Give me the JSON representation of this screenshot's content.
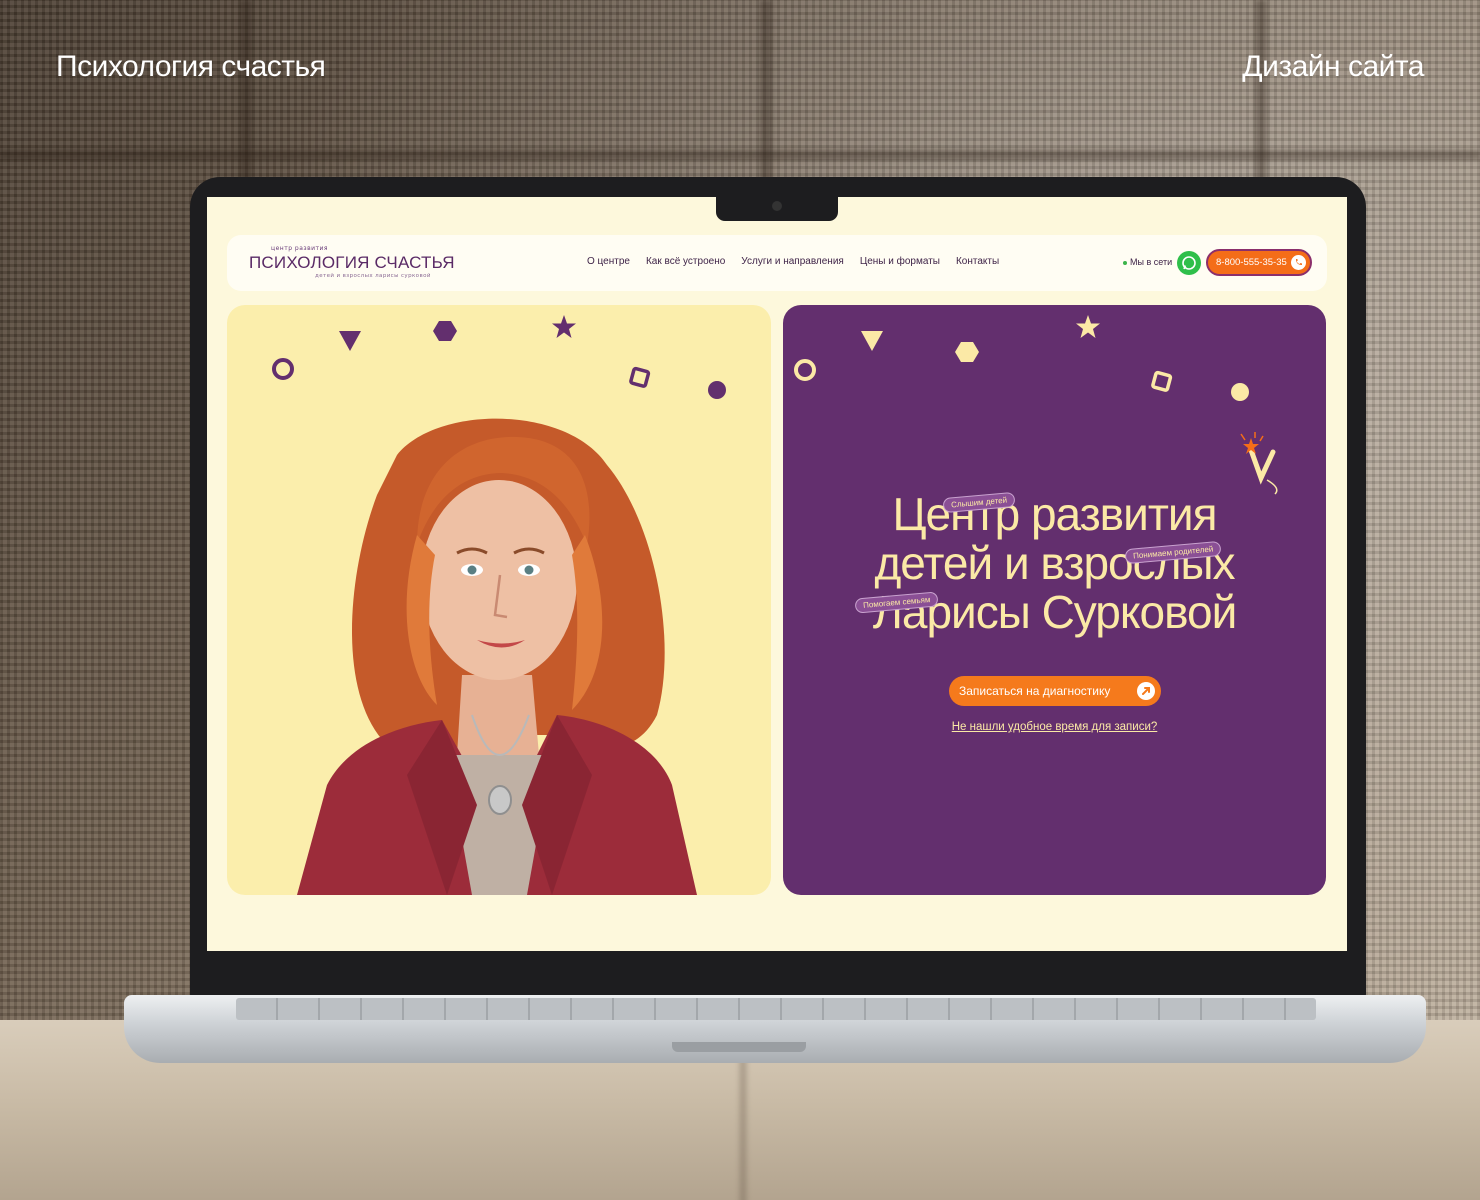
{
  "presentation": {
    "title_left": "Психология счастья",
    "title_right": "Дизайн сайта"
  },
  "site": {
    "logo": {
      "top": "центр развития",
      "main": "ПСИХОЛОГИЯ СЧАСТЬЯ",
      "sub": "детей и взрослых ларисы сурковой"
    },
    "nav": [
      "О центре",
      "Как всё устроено",
      "Услуги и направления",
      "Цены и форматы",
      "Контакты"
    ],
    "online_label": "Мы в сети",
    "phone": "8-800-555-35-35"
  },
  "hero": {
    "title_lines": [
      "Центр развития",
      "детей и взрослых",
      "Ларисы Сурковой"
    ],
    "tags": [
      "Слышим детей",
      "Понимаем родителей",
      "Помогаем семьям"
    ],
    "cta_label": "Записаться на диагностику",
    "alt_link": "Не нашли удобное время для записи?"
  },
  "colors": {
    "brand_purple": "#632f6e",
    "brand_yellow": "#fbeeac",
    "accent_orange": "#f46d18",
    "whatsapp_green": "#2fbf4a"
  },
  "icons": [
    "whatsapp-icon",
    "phone-icon",
    "arrow-up-right-icon",
    "camera-icon"
  ]
}
